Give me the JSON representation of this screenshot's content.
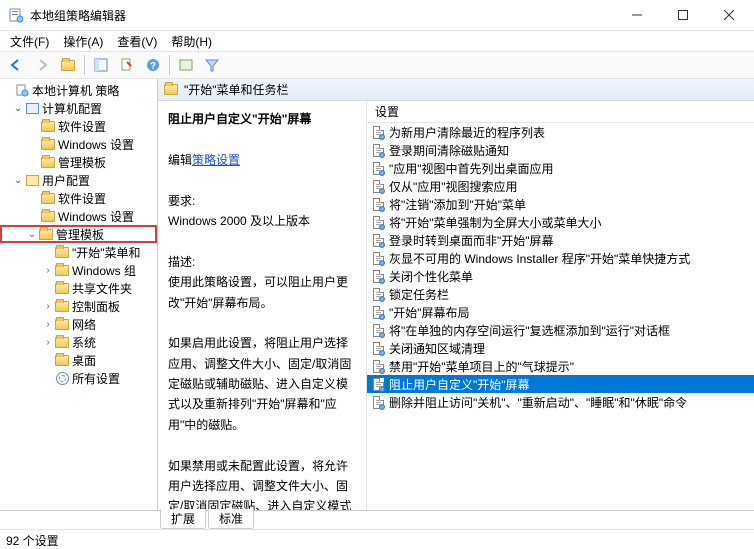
{
  "window": {
    "title": "本地组策略编辑器"
  },
  "menu": {
    "file": "文件(F)",
    "action": "操作(A)",
    "view": "查看(V)",
    "help": "帮助(H)"
  },
  "tree": {
    "root": "本地计算机 策略",
    "computer": "计算机配置",
    "c_soft": "软件设置",
    "c_win": "Windows 设置",
    "c_admin": "管理模板",
    "user": "用户配置",
    "u_soft": "软件设置",
    "u_win": "Windows 设置",
    "u_admin": "管理模板",
    "start": "\"开始\"菜单和",
    "wincomp": "Windows 组",
    "shared": "共享文件夹",
    "ctrl": "控制面板",
    "net": "网络",
    "sys": "系统",
    "desk": "桌面",
    "all": "所有设置"
  },
  "header": {
    "title": "\"开始\"菜单和任务栏"
  },
  "desc": {
    "policy_title": "阻止用户自定义\"开始\"屏幕",
    "edit_prefix": "编辑",
    "edit_link": "策略设置",
    "req_label": "要求:",
    "req_text": "Windows 2000 及以上版本",
    "desc_label": "描述:",
    "desc_p1": "使用此策略设置，可以阻止用户更改\"开始\"屏幕布局。",
    "desc_p2": "如果启用此设置，将阻止用户选择应用、调整文件大小、固定/取消固定磁贴或辅助磁贴、进入自定义模式以及重新排列\"开始\"屏幕和\"应用\"中的磁贴。",
    "desc_p3": "如果禁用或未配置此设置，将允许用户选择应用、调整文件大小、固定/取消固定磁贴、进入自定义模式以及重新排列\"开始\"屏幕和\"应用\"中的磁贴。"
  },
  "settings_header": "设置",
  "settings": [
    "为新用户清除最近的程序列表",
    "登录期间清除磁贴通知",
    "\"应用\"视图中首先列出桌面应用",
    "仅从\"应用\"视图搜索应用",
    "将\"注销\"添加到\"开始\"菜单",
    "将\"开始\"菜单强制为全屏大小或菜单大小",
    "登录时转到桌面而非\"开始\"屏幕",
    "灰显不可用的 Windows Installer 程序\"开始\"菜单快捷方式",
    "关闭个性化菜单",
    "锁定任务栏",
    "\"开始\"屏幕布局",
    "将\"在单独的内存空间运行\"复选框添加到\"运行\"对话框",
    "关闭通知区域清理",
    "禁用\"开始\"菜单项目上的\"气球提示\"",
    "阻止用户自定义\"开始\"屏幕",
    "删除并阻止访问\"关机\"、\"重新启动\"、\"睡眠\"和\"休眠\"命令"
  ],
  "selected_index": 14,
  "tabs": {
    "extended": "扩展",
    "standard": "标准"
  },
  "status": "92 个设置"
}
